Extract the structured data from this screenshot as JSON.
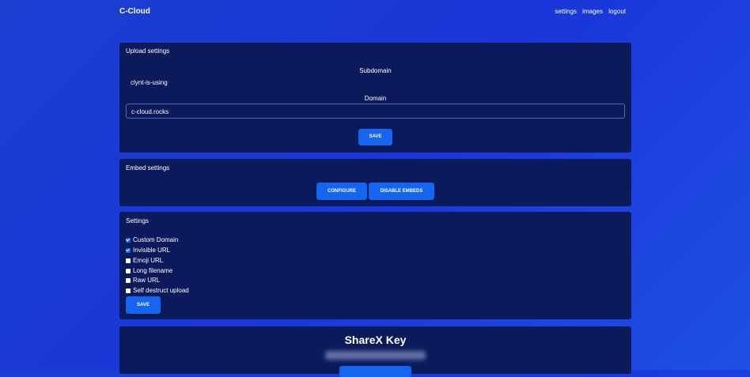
{
  "brand": "C-Cloud",
  "nav": {
    "settings": "settings",
    "images": "images",
    "logout": "logout"
  },
  "upload": {
    "title": "Upload settings",
    "subdomain_label": "Subdomain",
    "subdomain_value": "clynt-is-using",
    "domain_label": "Domain",
    "domain_value": "c-cloud.rocks",
    "save": "SAVE"
  },
  "embed": {
    "title": "Embed settings",
    "configure": "CONFIGURE",
    "disable": "DISABLE EMBEDS"
  },
  "settings": {
    "title": "Settings",
    "options": [
      {
        "label": "Custom Domain",
        "checked": true
      },
      {
        "label": "Invisible URL",
        "checked": true
      },
      {
        "label": "Emoji URL",
        "checked": false
      },
      {
        "label": "Long filename",
        "checked": false
      },
      {
        "label": "Raw URL",
        "checked": false
      },
      {
        "label": "Self destruct upload",
        "checked": false
      }
    ],
    "save": "SAVE"
  },
  "sharex": {
    "title": "ShareX Key"
  },
  "colors": {
    "accent": "#1466f0",
    "card": "#0a1a5a"
  }
}
